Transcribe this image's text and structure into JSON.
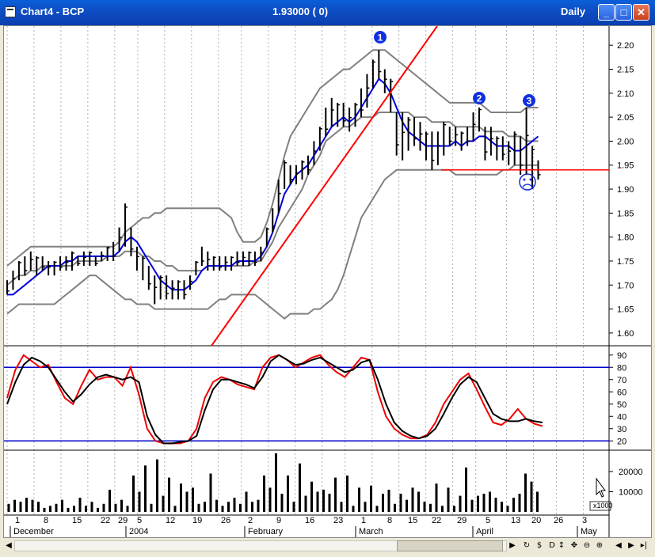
{
  "window": {
    "title": "Chart4 - BCP",
    "price_readout": "1.93000 ( 0)",
    "period": "Daily",
    "buttons": {
      "minimize": "_",
      "maximize": "□",
      "close": "✕"
    }
  },
  "colors": {
    "price": "#000000",
    "bollinger": "#808080",
    "ma": "#0000e0",
    "trendline": "#ff0000",
    "support": "#ff0000",
    "stoch_k": "#000000",
    "stoch_d": "#ee0000",
    "stoch_levels": "#0000cc",
    "marker": "#1030e0"
  },
  "markers": [
    {
      "label": "1"
    },
    {
      "label": "2"
    },
    {
      "label": "3"
    }
  ],
  "sad_face_icon": "frown-face-icon",
  "chart_data": [
    {
      "type": "ohlc",
      "name": "price",
      "ylim": [
        1.58,
        2.23
      ],
      "y_ticks": [
        "2.20",
        "2.15",
        "2.10",
        "2.05",
        "2.00",
        "1.95",
        "1.90",
        "1.85",
        "1.80",
        "1.75",
        "1.70",
        "1.65",
        "1.60"
      ],
      "y_tick_values": [
        2.2,
        2.15,
        2.1,
        2.05,
        2.0,
        1.95,
        1.9,
        1.85,
        1.8,
        1.75,
        1.7,
        1.65,
        1.6
      ],
      "support_level": 1.94,
      "grid": "vertical dotted",
      "bars_h": [
        1.71,
        1.73,
        1.75,
        1.76,
        1.77,
        1.76,
        1.76,
        1.75,
        1.75,
        1.76,
        1.76,
        1.77,
        1.76,
        1.77,
        1.77,
        1.76,
        1.77,
        1.78,
        1.79,
        1.82,
        1.87,
        1.82,
        1.78,
        1.76,
        1.74,
        1.72,
        1.72,
        1.72,
        1.71,
        1.71,
        1.71,
        1.72,
        1.75,
        1.78,
        1.77,
        1.76,
        1.76,
        1.76,
        1.76,
        1.77,
        1.77,
        1.77,
        1.77,
        1.78,
        1.82,
        1.86,
        1.92,
        1.96,
        1.95,
        1.95,
        1.96,
        1.97,
        2.0,
        2.03,
        2.07,
        2.09,
        2.08,
        2.08,
        2.07,
        2.08,
        2.11,
        2.14,
        2.17,
        2.19,
        2.15,
        2.13,
        2.06,
        2.06,
        2.05,
        2.05,
        2.04,
        2.02,
        2.02,
        2.02,
        2.04,
        2.03,
        2.03,
        2.02,
        2.03,
        2.06,
        2.07,
        2.03,
        2.03,
        2.01,
        2.01,
        2.0,
        2.02,
        2.01,
        2.07,
        1.99,
        1.96
      ],
      "bars_l": [
        1.68,
        1.69,
        1.71,
        1.72,
        1.73,
        1.72,
        1.73,
        1.72,
        1.72,
        1.73,
        1.73,
        1.73,
        1.74,
        1.74,
        1.74,
        1.74,
        1.75,
        1.75,
        1.75,
        1.77,
        1.78,
        1.76,
        1.73,
        1.71,
        1.69,
        1.66,
        1.67,
        1.67,
        1.67,
        1.67,
        1.67,
        1.69,
        1.72,
        1.74,
        1.73,
        1.73,
        1.73,
        1.73,
        1.73,
        1.74,
        1.74,
        1.74,
        1.74,
        1.75,
        1.78,
        1.81,
        1.85,
        1.9,
        1.91,
        1.91,
        1.92,
        1.93,
        1.95,
        1.98,
        2.01,
        2.03,
        2.03,
        2.03,
        2.02,
        2.03,
        2.05,
        2.07,
        2.11,
        2.13,
        2.1,
        2.06,
        1.97,
        1.96,
        1.98,
        1.99,
        1.98,
        1.96,
        1.94,
        1.95,
        1.97,
        1.99,
        1.99,
        1.98,
        1.99,
        2.0,
        2.02,
        1.96,
        1.97,
        1.96,
        1.96,
        1.95,
        1.95,
        1.93,
        1.93,
        1.9,
        1.92
      ],
      "bb_upper": [
        1.74,
        1.75,
        1.76,
        1.77,
        1.78,
        1.78,
        1.78,
        1.78,
        1.78,
        1.78,
        1.78,
        1.78,
        1.78,
        1.78,
        1.78,
        1.78,
        1.78,
        1.78,
        1.78,
        1.79,
        1.81,
        1.82,
        1.83,
        1.84,
        1.84,
        1.85,
        1.85,
        1.86,
        1.86,
        1.86,
        1.86,
        1.86,
        1.86,
        1.86,
        1.86,
        1.86,
        1.86,
        1.85,
        1.84,
        1.81,
        1.79,
        1.79,
        1.79,
        1.8,
        1.83,
        1.87,
        1.92,
        1.97,
        2.01,
        2.03,
        2.05,
        2.07,
        2.09,
        2.11,
        2.12,
        2.13,
        2.14,
        2.15,
        2.15,
        2.16,
        2.17,
        2.18,
        2.19,
        2.19,
        2.19,
        2.18,
        2.17,
        2.16,
        2.15,
        2.14,
        2.13,
        2.12,
        2.11,
        2.1,
        2.09,
        2.08,
        2.08,
        2.08,
        2.08,
        2.08,
        2.08,
        2.07,
        2.06,
        2.06,
        2.06,
        2.06,
        2.06,
        2.06,
        2.07,
        2.07,
        2.07
      ],
      "bb_mid": [
        1.7,
        1.71,
        1.72,
        1.72,
        1.73,
        1.73,
        1.74,
        1.74,
        1.74,
        1.74,
        1.74,
        1.74,
        1.75,
        1.75,
        1.75,
        1.75,
        1.75,
        1.76,
        1.76,
        1.76,
        1.77,
        1.77,
        1.77,
        1.76,
        1.76,
        1.75,
        1.75,
        1.74,
        1.74,
        1.73,
        1.73,
        1.73,
        1.73,
        1.73,
        1.74,
        1.74,
        1.74,
        1.74,
        1.74,
        1.74,
        1.74,
        1.74,
        1.75,
        1.75,
        1.77,
        1.79,
        1.82,
        1.84,
        1.86,
        1.88,
        1.9,
        1.93,
        1.95,
        1.97,
        2.0,
        2.01,
        2.02,
        2.03,
        2.03,
        2.04,
        2.05,
        2.05,
        2.05,
        2.06,
        2.06,
        2.06,
        2.06,
        2.06,
        2.06,
        2.05,
        2.05,
        2.05,
        2.04,
        2.04,
        2.04,
        2.04,
        2.03,
        2.03,
        2.03,
        2.03,
        2.03,
        2.02,
        2.02,
        2.02,
        2.02,
        2.01,
        2.01,
        2.01,
        2.0,
        2.0,
        2.0
      ],
      "bb_lower": [
        1.64,
        1.65,
        1.66,
        1.66,
        1.66,
        1.66,
        1.66,
        1.66,
        1.66,
        1.67,
        1.68,
        1.69,
        1.7,
        1.71,
        1.72,
        1.72,
        1.71,
        1.7,
        1.69,
        1.68,
        1.67,
        1.67,
        1.66,
        1.66,
        1.66,
        1.65,
        1.65,
        1.65,
        1.65,
        1.65,
        1.65,
        1.65,
        1.65,
        1.65,
        1.65,
        1.66,
        1.67,
        1.67,
        1.68,
        1.68,
        1.68,
        1.68,
        1.68,
        1.67,
        1.66,
        1.65,
        1.64,
        1.63,
        1.64,
        1.64,
        1.64,
        1.64,
        1.65,
        1.65,
        1.66,
        1.67,
        1.69,
        1.72,
        1.76,
        1.8,
        1.84,
        1.86,
        1.88,
        1.9,
        1.92,
        1.93,
        1.94,
        1.94,
        1.94,
        1.94,
        1.94,
        1.94,
        1.94,
        1.94,
        1.94,
        1.94,
        1.93,
        1.93,
        1.93,
        1.93,
        1.93,
        1.93,
        1.93,
        1.93,
        1.94,
        1.94,
        1.95,
        1.95,
        1.95,
        1.95,
        1.95
      ],
      "ma": [
        1.68,
        1.68,
        1.69,
        1.7,
        1.71,
        1.72,
        1.73,
        1.74,
        1.74,
        1.74,
        1.75,
        1.75,
        1.76,
        1.76,
        1.76,
        1.76,
        1.76,
        1.76,
        1.76,
        1.77,
        1.79,
        1.8,
        1.79,
        1.77,
        1.75,
        1.73,
        1.71,
        1.7,
        1.69,
        1.69,
        1.69,
        1.7,
        1.71,
        1.73,
        1.74,
        1.74,
        1.74,
        1.74,
        1.74,
        1.75,
        1.75,
        1.75,
        1.75,
        1.76,
        1.78,
        1.81,
        1.85,
        1.89,
        1.91,
        1.93,
        1.94,
        1.95,
        1.97,
        1.99,
        2.01,
        2.03,
        2.04,
        2.05,
        2.04,
        2.05,
        2.07,
        2.09,
        2.11,
        2.13,
        2.12,
        2.1,
        2.07,
        2.04,
        2.02,
        2.01,
        2.0,
        1.99,
        1.99,
        1.99,
        1.99,
        1.99,
        2.0,
        1.99,
        2.0,
        2.0,
        2.01,
        2.01,
        2.0,
        1.99,
        1.99,
        1.99,
        1.98,
        1.98,
        1.99,
        2.0,
        2.01
      ],
      "trendline": [
        [
          0,
          1.58
        ],
        [
          1,
          1.95
        ]
      ]
    },
    {
      "type": "line",
      "name": "stochastic",
      "ylim": [
        15,
        95
      ],
      "y_ticks": [
        "90",
        "80",
        "70",
        "60",
        "50",
        "40",
        "30",
        "20"
      ],
      "y_tick_values": [
        90,
        80,
        70,
        60,
        50,
        40,
        30,
        20
      ],
      "levels": [
        80,
        20
      ],
      "series": [
        {
          "values": [
            50,
            68,
            82,
            88,
            85,
            80,
            70,
            60,
            52,
            58,
            66,
            72,
            74,
            72,
            70,
            72,
            68,
            40,
            25,
            18,
            18,
            19,
            20,
            24,
            45,
            62,
            70,
            70,
            68,
            66,
            63,
            72,
            85,
            90,
            86,
            82,
            83,
            86,
            88,
            84,
            80,
            76,
            78,
            84,
            86,
            70,
            50,
            35,
            28,
            24,
            22,
            24,
            30,
            42,
            55,
            66,
            72,
            68,
            55,
            42,
            38,
            36,
            36,
            38,
            36,
            35
          ]
        },
        {
          "values": [
            55,
            78,
            90,
            85,
            80,
            82,
            68,
            55,
            50,
            65,
            78,
            70,
            72,
            72,
            65,
            80,
            58,
            30,
            20,
            18,
            18,
            18,
            20,
            30,
            55,
            68,
            72,
            70,
            66,
            64,
            62,
            80,
            88,
            90,
            86,
            80,
            84,
            88,
            90,
            82,
            76,
            72,
            80,
            88,
            86,
            60,
            40,
            30,
            25,
            22,
            22,
            25,
            35,
            50,
            60,
            70,
            75,
            62,
            48,
            35,
            33,
            38,
            46,
            38,
            34,
            32
          ]
        }
      ]
    },
    {
      "type": "bar",
      "name": "volume",
      "ylim": [
        0,
        29000
      ],
      "y_ticks": [
        "20000",
        "10000"
      ],
      "y_tick_values": [
        20000,
        10000
      ],
      "unit_label": "x1000",
      "values": [
        4000,
        6000,
        5000,
        7000,
        6000,
        5000,
        2000,
        3000,
        4000,
        6000,
        2000,
        3000,
        7000,
        3000,
        5000,
        2000,
        4000,
        11000,
        4000,
        6000,
        3000,
        18000,
        10000,
        23000,
        4000,
        26000,
        8000,
        17000,
        3000,
        14000,
        10000,
        12000,
        4000,
        5000,
        19000,
        6000,
        3000,
        5000,
        7000,
        4000,
        10000,
        5000,
        6000,
        18000,
        12000,
        29000,
        9000,
        18000,
        5000,
        24000,
        8000,
        15000,
        10000,
        11000,
        9000,
        17000,
        5000,
        18000,
        3000,
        12000,
        5000,
        13000,
        3000,
        9000,
        11000,
        4000,
        9000,
        6000,
        12000,
        10000,
        5000,
        4000,
        14000,
        3000,
        12000,
        3000,
        8000,
        22000,
        6000,
        8000,
        9000,
        10000,
        7000,
        5000,
        3000,
        7000,
        9000,
        19000,
        15000,
        10000
      ]
    },
    {
      "type": "axis",
      "name": "time",
      "tick_labels": [
        "1",
        "8",
        "15",
        "22",
        "29",
        "5",
        "12",
        "19",
        "26",
        "2",
        "9",
        "16",
        "23",
        "1",
        "8",
        "15",
        "22",
        "29",
        "5",
        "13",
        "20",
        "26",
        "3"
      ],
      "months": [
        "December",
        "2004",
        "February",
        "March",
        "April",
        "May"
      ]
    }
  ]
}
